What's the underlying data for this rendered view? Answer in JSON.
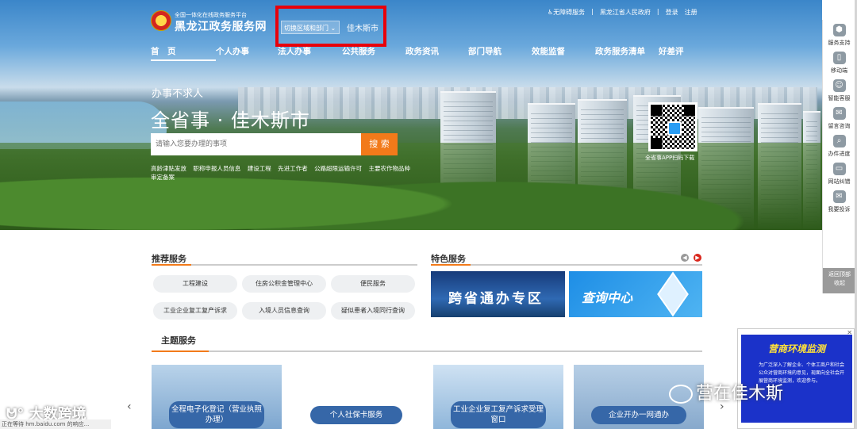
{
  "header": {
    "site_subtitle": "全国一体化在线政务服务平台",
    "site_title": "黑龙江政务服务网",
    "region_switch": "切换区域和部门",
    "region_city": "佳木斯市",
    "top_links": [
      "无障碍服务",
      "黑龙江省人民政府",
      "登录",
      "注册"
    ]
  },
  "nav": {
    "items": [
      "首　页",
      "个人办事",
      "法人办事",
      "公共服务",
      "政务资讯",
      "部门导航",
      "效能监督",
      "政务服务清单",
      "好差评"
    ]
  },
  "hero": {
    "slogan_small": "办事不求人",
    "slogan_large": "全省事 · 佳木斯市",
    "search_placeholder": "请输入您要办理的事项",
    "search_button": "搜 索",
    "hot_words": [
      "高龄津贴发放",
      "职称申报人员信息",
      "建设工程",
      "先进工作者",
      "公路超限运输许可",
      "主要农作物品种审定备案"
    ],
    "qr_label": "全省事APP扫码下载"
  },
  "sidebar": {
    "items": [
      {
        "label": "服务支持",
        "icon": "support-icon"
      },
      {
        "label": "移动端",
        "icon": "mobile-icon"
      },
      {
        "label": "智能客服",
        "icon": "robot-icon"
      },
      {
        "label": "留言咨询",
        "icon": "message-icon"
      },
      {
        "label": "办件进度",
        "icon": "progress-icon"
      },
      {
        "label": "网站纠错",
        "icon": "monitor-icon"
      },
      {
        "label": "我要投诉",
        "icon": "mail-icon"
      }
    ],
    "bottom": [
      "返回顶部",
      "收起"
    ]
  },
  "recommended": {
    "title": "推荐服务",
    "items": [
      "工程建设",
      "住房公积金管理中心",
      "便民服务",
      "工业企业复工复产诉求",
      "入境人员信息查询",
      "疑似患者入境同行查询"
    ]
  },
  "featured": {
    "title": "特色服务",
    "banners": [
      "跨省通办专区",
      "查询中心"
    ]
  },
  "themes": {
    "title": "主题服务",
    "cards": [
      {
        "label": "全程电子化登记（营业执照办理）"
      },
      {
        "label": "个人社保卡服务"
      },
      {
        "label": "工业企业复工复产诉求受理窗口"
      },
      {
        "label": "企业开办一网通办"
      }
    ]
  },
  "ad": {
    "title": "营商环境监测",
    "text": "为广泛深入了解企业、个体工商户和社会公众对营商环境的意见，现面向全社会开展营商环境监测，欢迎参与。"
  },
  "watermarks": {
    "left": "大数跨境",
    "right": "营在佳木斯"
  },
  "statusbar": "正在等待 hm.baidu.com 的响应...",
  "colors": {
    "accent": "#f27a1a",
    "highlight_box": "#e8000b",
    "banner_blue": "#1e8ee6"
  }
}
